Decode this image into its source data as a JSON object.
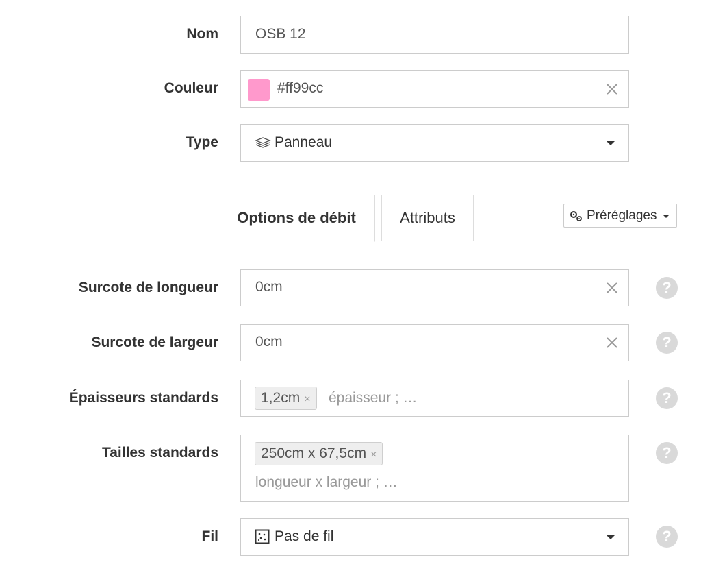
{
  "form": {
    "nom": {
      "label": "Nom",
      "value": "OSB 12"
    },
    "couleur": {
      "label": "Couleur",
      "value": "#ff99cc",
      "swatch_color": "#ff99cc"
    },
    "type": {
      "label": "Type",
      "value": "Panneau",
      "icon": "layers-icon"
    }
  },
  "tabs": [
    {
      "label": "Options de débit",
      "active": true
    },
    {
      "label": "Attributs",
      "active": false
    }
  ],
  "presets_button": {
    "label": "Préréglages",
    "icon": "cogs-icon"
  },
  "options": {
    "surcote_longueur": {
      "label": "Surcote de longueur",
      "value": "0cm"
    },
    "surcote_largeur": {
      "label": "Surcote de largeur",
      "value": "0cm"
    },
    "epaisseurs": {
      "label": "Épaisseurs standards",
      "tag": "1,2cm",
      "placeholder": "épaisseur ; …"
    },
    "tailles": {
      "label": "Tailles standards",
      "tag": "250cm x 67,5cm",
      "placeholder": "longueur x largeur ; …"
    },
    "fil": {
      "label": "Fil",
      "value": "Pas de fil",
      "icon": "grain-icon"
    }
  },
  "help_text": "?",
  "remove_glyph": "×",
  "colors": {
    "border": "#cccccc",
    "help_bg": "#d9d9d9",
    "tag_bg": "#eeeeee"
  }
}
